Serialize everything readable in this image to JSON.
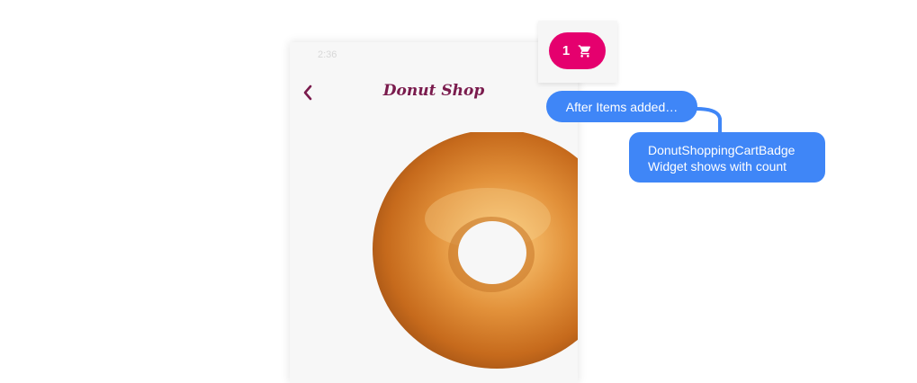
{
  "status_bar": {
    "time": "2:36"
  },
  "app_bar": {
    "title": "Donut Shop",
    "back_icon": "chevron-left-icon"
  },
  "hero_image": {
    "description_name": "glazed-donut-image"
  },
  "cart_badge": {
    "count": "1",
    "icon": "shopping-cart-icon",
    "color": "#e5006e"
  },
  "annotations": {
    "note1": "After Items added…",
    "note2_line1": "DonutShoppingCartBadge",
    "note2_line2": "Widget shows with count",
    "color": "#3f86f7"
  },
  "colors": {
    "title": "#7a1b4d",
    "badge": "#e5006e",
    "callout": "#3f86f7"
  }
}
